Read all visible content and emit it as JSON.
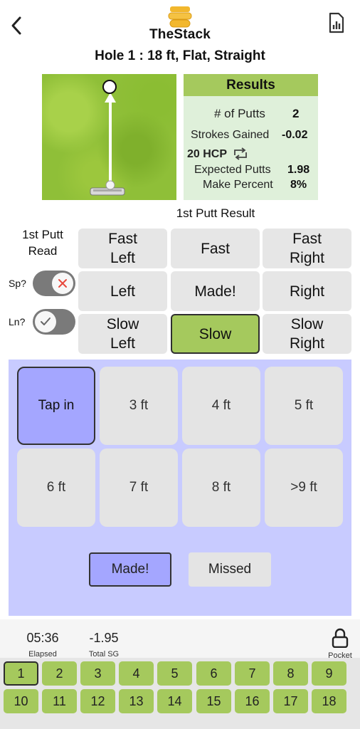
{
  "header": {
    "app_title": "TheStack",
    "hole_title": "Hole 1  :  18 ft, Flat, Straight"
  },
  "results": {
    "heading": "Results",
    "num_putts_label": "# of Putts",
    "num_putts_value": "2",
    "strokes_gained_label": "Strokes Gained",
    "strokes_gained_value": "-0.02",
    "hcp_label": "20 HCP",
    "expected_putts_label": "Expected Putts",
    "expected_putts_value": "1.98",
    "make_percent_label": "Make Percent",
    "make_percent_value": "8%"
  },
  "putt_result": {
    "title": "1st Putt Result",
    "read_label": "1st Putt\nRead",
    "speed_label": "Sp?",
    "line_label": "Ln?",
    "speed_toggle_icon": "x-icon",
    "line_toggle_icon": "check-icon",
    "buttons": {
      "fast_left": "Fast\nLeft",
      "fast": "Fast",
      "fast_right": "Fast\nRight",
      "left": "Left",
      "made": "Made!",
      "right": "Right",
      "slow_left": "Slow\nLeft",
      "slow": "Slow",
      "slow_right": "Slow\nRight"
    },
    "selected": "slow"
  },
  "distance": {
    "options": [
      "Tap in",
      "3 ft",
      "4 ft",
      "5 ft",
      "6 ft",
      "7 ft",
      "8 ft",
      ">9 ft"
    ],
    "selected": "Tap in",
    "made_label": "Made!",
    "missed_label": "Missed"
  },
  "footer": {
    "elapsed_value": "05:36",
    "elapsed_label": "Elapsed",
    "total_sg_value": "-1.95",
    "total_sg_label": "Total SG",
    "pocket_label": "Pocket",
    "holes": [
      "1",
      "2",
      "3",
      "4",
      "5",
      "6",
      "7",
      "8",
      "9",
      "10",
      "11",
      "12",
      "13",
      "14",
      "15",
      "16",
      "17",
      "18"
    ],
    "current_hole": "1"
  },
  "colors": {
    "green_accent": "#a5c95d",
    "results_bg": "#dff0da",
    "blue_panel": "#c8cbff",
    "blue_selected": "#a4a6ff",
    "logo_gold": "#f2b72d"
  }
}
